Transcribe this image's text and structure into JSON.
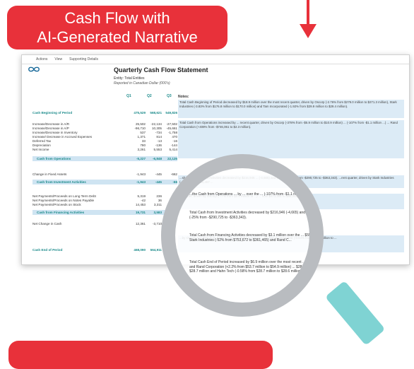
{
  "banner": {
    "line1": "Cash Flow with",
    "line2": "AI-Generated Narrative"
  },
  "toolbar": {
    "actions": "Actions",
    "view": "View",
    "supporting": "Supporting Details"
  },
  "report": {
    "title": "Quarterly Cash Flow Statement",
    "entity": "Entity: Total Entities",
    "reported": "Reported in Canadian Dollar (000's)",
    "columns": [
      "Q1",
      "Q2",
      "Q3"
    ],
    "notes_label": "Notes:"
  },
  "rows": [
    {
      "label": "Cash Beginning of Period",
      "q1": "475,529",
      "q2": "568,621",
      "q3": "549,826",
      "style": "bold"
    },
    {
      "label": "Increase/Decrease in A/R",
      "q1": "25,502",
      "q2": "-22,134",
      "q3": "-27,502"
    },
    {
      "label": "Increase/Decrease in A/P",
      "q1": "-96,710",
      "q2": "10,305",
      "q3": "-45,661"
    },
    {
      "label": "Increase/Decrease in Inventory",
      "q1": "537",
      "q2": "-734",
      "q3": "-1,758"
    },
    {
      "label": "Increase/ Decrease in Accrued Expenses",
      "q1": "1,371",
      "q2": "814",
      "q3": "470"
    },
    {
      "label": "Deferred Tax",
      "q1": "33",
      "q2": "-13",
      "q3": "-16"
    },
    {
      "label": "Depreciation",
      "q1": "780",
      "q2": "-136",
      "q3": "-144"
    },
    {
      "label": "Net Income",
      "q1": "3,261",
      "q2": "5,553",
      "q3": "5,414"
    },
    {
      "label": "Cash from Operations",
      "q1": "-5,227",
      "q2": "-6,848",
      "q3": "22,125",
      "style": "band"
    },
    {
      "label": "Change in Fixed Assets",
      "q1": "-1,943",
      "q2": "-445",
      "q3": "-662"
    },
    {
      "label": "Cash from Investment Activities",
      "q1": "-1,943",
      "q2": "-445",
      "q3": "-66",
      "style": "band"
    },
    {
      "label": "Net Payments/Proceeds on Long Term Debt",
      "q1": "5,319",
      "q2": "236",
      "q3": "-4"
    },
    {
      "label": "Net Payments/Proceeds on Notes Payable",
      "q1": "-42",
      "q2": "36",
      "q3": ""
    },
    {
      "label": "Net Payments/Proceeds on Stock",
      "q1": "14,453",
      "q2": "3,311",
      "q3": ""
    },
    {
      "label": "Cash from Financing Activities",
      "q1": "19,731",
      "q2": "3,583",
      "q3": "",
      "style": "band"
    },
    {
      "label": "Net Change in Cash",
      "q1": "12,361",
      "q2": "-3,710",
      "q3": ""
    },
    {
      "label": "Cash End of Period",
      "q1": "468,090",
      "q2": "564,911",
      "q3": "5",
      "style": "bold"
    }
  ],
  "notes": {
    "n1": "Total Cash Beginning of Period decreased by $18.9 million over the most recent quarter, driven by Oscorp (-2.76% from $279.0 million to $271.3 million), Stark Industries (-3.83% from $176.8 million to $170.0 million) and Tam Incorporated (-1.92% from $29.9 million to $29.4 million).",
    "n2": "Total Cash from Operations increased by ... recent quarter, driven by Oscorp (-378% from -$5.9 million to $10.9 million) ... (-107% from -$1.1 million ...) ... Rand Corporation (+408% from -$746,061 to $2.3 million).",
    "n3": "...sh from Investment Activities decreased by $216,946 ... (-4,665) and Oscorp (-25% from -$290,725 to -$363,343). ...rent quarter, driven by Stark Industries (-148% from -$90,457 ...",
    "n4": "...quarter, driven by Oscorp (-77% from $2.4 million to ...) ... from $473,381 to $86,048).",
    "n5": "...by Oscorp (+1.92% from $277.1 million to $282.4 million) ... by Tam Incorporated (-0.64% from $29.1 million to ..."
  },
  "magnifier": {
    "t1": "...the Cash from Operations ... by ... over the ... (-107% from -$1.1 million ...",
    "t2": "Total Cash from Investment Activities decreased by $216,946 (-4,665) and Oscorp (-25% from -$290,725 to -$363,343).",
    "t3": "Total Cash from Financing Activities decreased by $3.1 million over the ... $550,133), Stark Industries (-52% from $753,672 to $361,465) and Rand C...",
    "t4": "Total Cash End of Period increased by $6.9 million over the most recent ... million) and Rand Corporation (+2.2% from $53.7 million to $54.9 million) ... $28.9 million to $28.7 million and Hahn Tech (-0.58% from $28.7 million to $28.6 million)."
  },
  "colors": {
    "accent": "#e8313a",
    "teal": "#1a8a8a",
    "band": "#cfe4f2"
  }
}
